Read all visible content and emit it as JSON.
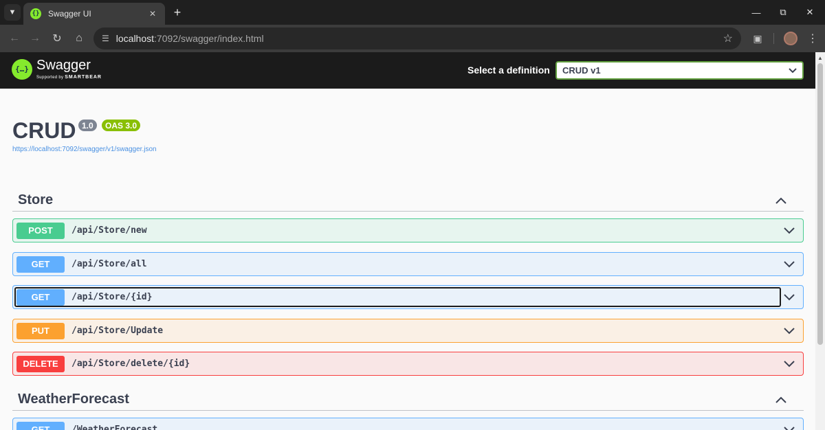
{
  "browser": {
    "tab_title": "Swagger UI",
    "url_host": "localhost",
    "url_rest": ":7092/swagger/index.html"
  },
  "topbar": {
    "logo_name": "Swagger",
    "logo_supported": "Supported by",
    "logo_brand": "SMARTBEAR",
    "definition_label": "Select a definition",
    "definition_value": "CRUD v1"
  },
  "info": {
    "title": "CRUD",
    "version": "1.0",
    "oas": "OAS 3.0",
    "spec_url": "https://localhost:7092/swagger/v1/swagger.json"
  },
  "tags": [
    {
      "name": "Store",
      "expanded": true,
      "operations": [
        {
          "method": "POST",
          "path": "/api/Store/new"
        },
        {
          "method": "GET",
          "path": "/api/Store/all"
        },
        {
          "method": "GET",
          "path": "/api/Store/{id}",
          "focused": true
        },
        {
          "method": "PUT",
          "path": "/api/Store/Update"
        },
        {
          "method": "DELETE",
          "path": "/api/Store/delete/{id}"
        }
      ]
    },
    {
      "name": "WeatherForecast",
      "expanded": true,
      "operations": [
        {
          "method": "GET",
          "path": "/WeatherForecast"
        }
      ]
    }
  ],
  "colors": {
    "post": "#49cc90",
    "get": "#61affe",
    "put": "#fca130",
    "delete": "#f93e3e",
    "swagger_green": "#85ea2d"
  }
}
